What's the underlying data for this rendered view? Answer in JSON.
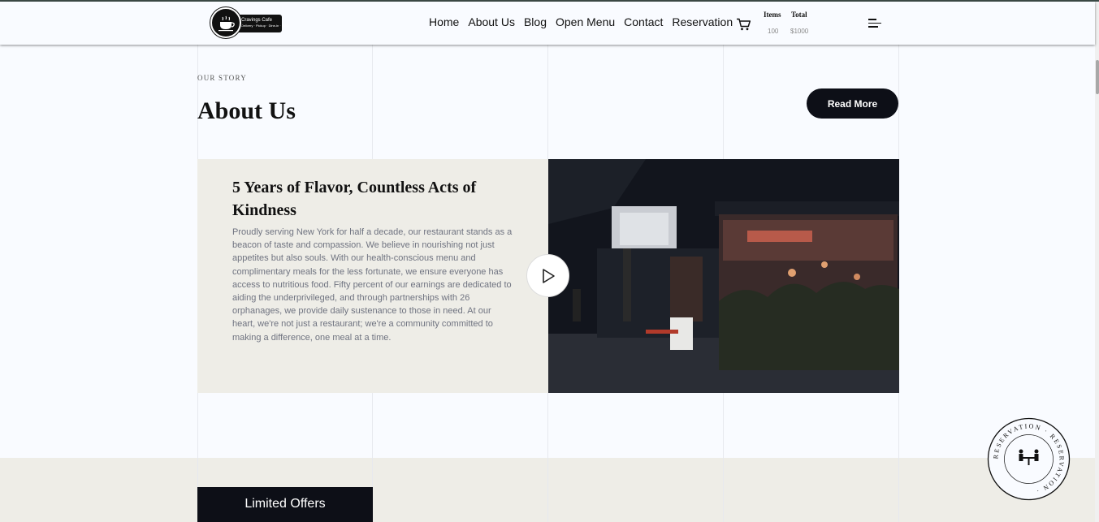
{
  "brand": {
    "name": "Cravings Cafe",
    "tagline": "Delivery · Pickup · Dine-in · BYO"
  },
  "nav": [
    {
      "label": "Home"
    },
    {
      "label": "About Us"
    },
    {
      "label": "Blog"
    },
    {
      "label": "Open Menu"
    },
    {
      "label": "Contact"
    },
    {
      "label": "Reservation"
    }
  ],
  "cart": {
    "items_label": "Items",
    "total_label": "Total",
    "items_value": "100",
    "total_value": "$1000"
  },
  "section": {
    "eyebrow": "OUR STORY",
    "title": "About Us",
    "read_more": "Read More"
  },
  "story": {
    "heading": "5 Years of Flavor, Countless Acts of Kindness",
    "body": "Proudly serving New York for half a decade, our restaurant stands as a beacon of taste and compassion. We believe in nourishing not just appetites but also souls. With our health-conscious menu and complimentary meals for the less fortunate, we ensure everyone has access to nutritious food. Fifty percent of our earnings are dedicated to aiding the underprivileged, and through partnerships with 26 orphanages, we provide daily sustenance to those in need. At our heart, we're not just a restaurant; we're a community committed to making a difference, one meal at a time."
  },
  "offers": {
    "label": "Limited Offers"
  },
  "reservation_badge": {
    "text": "RESERVATION · RESERVATION ·"
  },
  "colors": {
    "dark": "#0d0f17",
    "beige": "#eeede7",
    "page": "#f9fbff",
    "muted_text": "#6f7380"
  },
  "icons": [
    "coffee-cup-icon",
    "cart-icon",
    "menu-icon",
    "play-icon",
    "dining-table-icon"
  ]
}
